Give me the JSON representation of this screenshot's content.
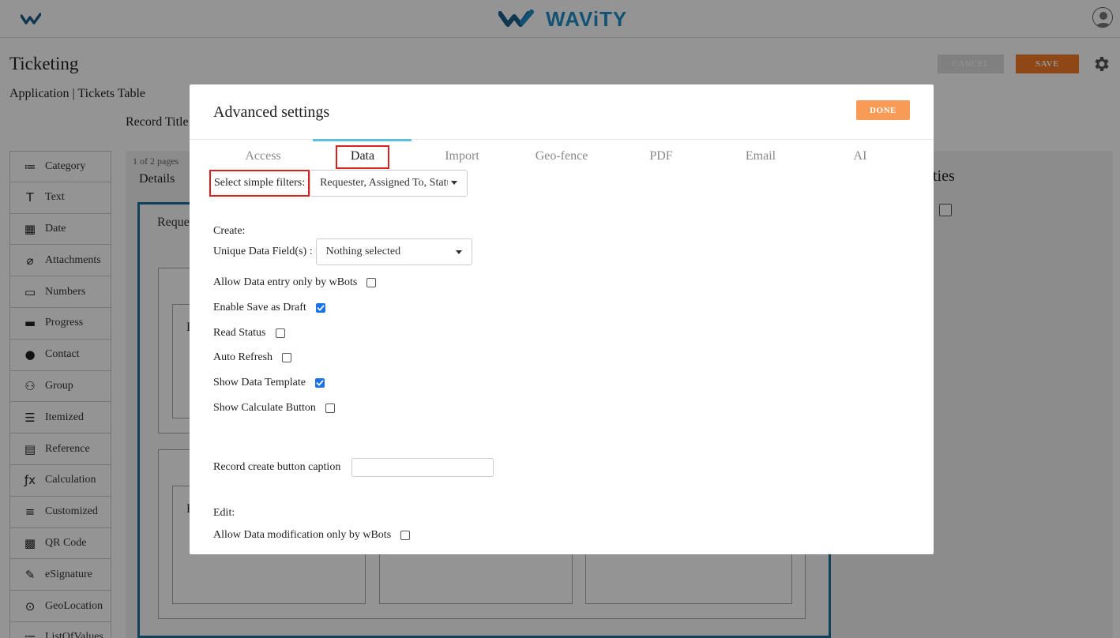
{
  "app": {
    "brand": "WAViTY",
    "page_title": "Ticketing",
    "breadcrumb": "Application | Tickets Table",
    "record_title_label": "Record Title",
    "cancel_label": "CANCEL",
    "save_label": "SAVE",
    "icons": {
      "logo": "wavity-check-logo",
      "user": "user-avatar-icon",
      "settings": "gear-icon"
    }
  },
  "toolbox": {
    "items": [
      {
        "label": "Category",
        "icon": "≔"
      },
      {
        "label": "Text",
        "icon": "T"
      },
      {
        "label": "Date",
        "icon": "▦"
      },
      {
        "label": "Attachments",
        "icon": "⌀"
      },
      {
        "label": "Numbers",
        "icon": "▭"
      },
      {
        "label": "Progress",
        "icon": "▬"
      },
      {
        "label": "Contact",
        "icon": "●"
      },
      {
        "label": "Group",
        "icon": "⚇"
      },
      {
        "label": "Itemized",
        "icon": "☰"
      },
      {
        "label": "Reference",
        "icon": "▤"
      },
      {
        "label": "Calculation",
        "icon": "ƒx"
      },
      {
        "label": "Customized",
        "icon": "≡"
      },
      {
        "label": "QR Code",
        "icon": "▩"
      },
      {
        "label": "eSignature",
        "icon": "✎"
      },
      {
        "label": "GeoLocation",
        "icon": "⊙"
      },
      {
        "label": "ListOfValues",
        "icon": "≔"
      }
    ]
  },
  "canvas": {
    "pages_info": "1 of 2 pages",
    "details_tab": "Details",
    "requester_label": "Reque",
    "properties_title": "ties",
    "cut_label_1": "F",
    "cut_label_2": "F"
  },
  "modal": {
    "title": "Advanced settings",
    "done_label": "DONE",
    "tabs": [
      {
        "label": "Access",
        "active": false
      },
      {
        "label": "Data",
        "active": true
      },
      {
        "label": "Import",
        "active": false
      },
      {
        "label": "Geo-fence",
        "active": false
      },
      {
        "label": "PDF",
        "active": false
      },
      {
        "label": "Email",
        "active": false
      },
      {
        "label": "AI",
        "active": false
      }
    ],
    "simple_filters": {
      "label": "Select simple filters:",
      "value": "Requester, Assigned To, Statu"
    },
    "create_heading": "Create:",
    "unique_fields": {
      "label": "Unique Data Field(s) :",
      "value": "Nothing selected"
    },
    "options": [
      {
        "label": "Allow Data entry only by wBots",
        "checked": false
      },
      {
        "label": "Enable Save as Draft",
        "checked": true
      },
      {
        "label": "Read Status",
        "checked": false
      },
      {
        "label": "Auto Refresh",
        "checked": false
      },
      {
        "label": "Show Data Template",
        "checked": true
      },
      {
        "label": "Show Calculate Button",
        "checked": false
      }
    ],
    "caption_label": "Record create button caption",
    "caption_value": "",
    "edit_heading": "Edit:",
    "edit_option": {
      "label": "Allow Data modification only by wBots",
      "checked": false
    }
  },
  "colors": {
    "brand_blue": "#1e8ec9",
    "save_orange": "#f47a25",
    "done_orange": "#f79b57",
    "highlight_red": "#d9211f",
    "tab_accent": "#5bc0de",
    "checkbox_blue": "#1a73e8"
  }
}
